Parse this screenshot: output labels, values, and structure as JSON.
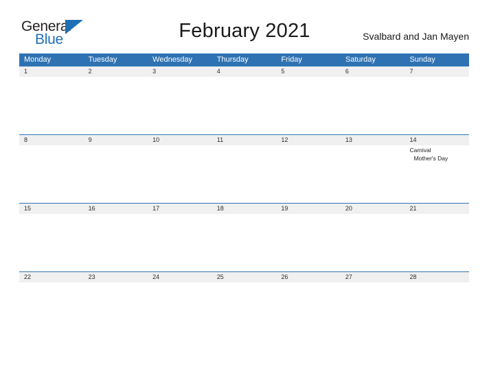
{
  "brand": {
    "name_part1": "General",
    "name_part2": "Blue",
    "flag_icon": "triangle-flag-icon",
    "accent_color": "#1f6fb5"
  },
  "header": {
    "title": "February 2021",
    "location": "Svalbard and Jan Mayen"
  },
  "calendar": {
    "header_bg_color": "#2f72b3",
    "date_band_bg_color": "#f0f0f0",
    "rule_color": "#2f72b3",
    "day_names": [
      "Monday",
      "Tuesday",
      "Wednesday",
      "Thursday",
      "Friday",
      "Saturday",
      "Sunday"
    ],
    "weeks": [
      {
        "days": [
          {
            "number": "1",
            "events": []
          },
          {
            "number": "2",
            "events": []
          },
          {
            "number": "3",
            "events": []
          },
          {
            "number": "4",
            "events": []
          },
          {
            "number": "5",
            "events": []
          },
          {
            "number": "6",
            "events": []
          },
          {
            "number": "7",
            "events": []
          }
        ]
      },
      {
        "days": [
          {
            "number": "8",
            "events": []
          },
          {
            "number": "9",
            "events": []
          },
          {
            "number": "10",
            "events": []
          },
          {
            "number": "11",
            "events": []
          },
          {
            "number": "12",
            "events": []
          },
          {
            "number": "13",
            "events": []
          },
          {
            "number": "14",
            "events": [
              {
                "label": "Carnival",
                "indent": false
              },
              {
                "label": "Mother's Day",
                "indent": true
              }
            ]
          }
        ]
      },
      {
        "days": [
          {
            "number": "15",
            "events": []
          },
          {
            "number": "16",
            "events": []
          },
          {
            "number": "17",
            "events": []
          },
          {
            "number": "18",
            "events": []
          },
          {
            "number": "19",
            "events": []
          },
          {
            "number": "20",
            "events": []
          },
          {
            "number": "21",
            "events": []
          }
        ]
      },
      {
        "days": [
          {
            "number": "22",
            "events": []
          },
          {
            "number": "23",
            "events": []
          },
          {
            "number": "24",
            "events": []
          },
          {
            "number": "25",
            "events": []
          },
          {
            "number": "26",
            "events": []
          },
          {
            "number": "27",
            "events": []
          },
          {
            "number": "28",
            "events": []
          }
        ]
      }
    ]
  }
}
